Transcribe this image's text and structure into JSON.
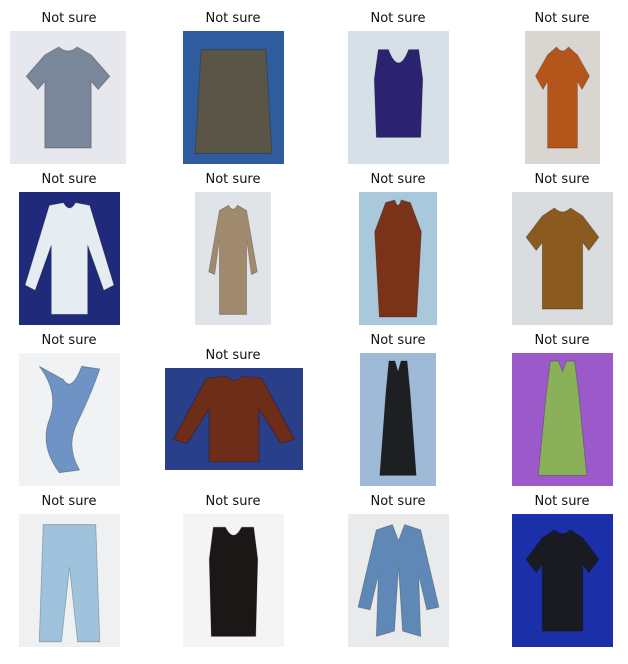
{
  "grid": {
    "cells": [
      {
        "label": "Not sure",
        "image": "grey-tshirt-on-bedsheet",
        "bg": "#e6e8ee",
        "garment": "#7a8699"
      },
      {
        "label": "Not sure",
        "image": "tweed-skirt-on-denim",
        "bg": "#2f5c9e",
        "garment": "#5b5547"
      },
      {
        "label": "Not sure",
        "image": "purple-vest-on-tiles",
        "bg": "#d7e0e6",
        "garment": "#2c2370"
      },
      {
        "label": "Not sure",
        "image": "rust-tshirt-on-hanger",
        "bg": "#d9d6d2",
        "garment": "#b4561c"
      },
      {
        "label": "Not sure",
        "image": "white-blouse-on-navy",
        "bg": "#1f2a7a",
        "garment": "#e5ecf2"
      },
      {
        "label": "Not sure",
        "image": "beige-shirt-on-hanger",
        "bg": "#e0e4e8",
        "garment": "#a08a6e"
      },
      {
        "label": "Not sure",
        "image": "rust-tunic-on-blue",
        "bg": "#a9c8dc",
        "garment": "#7a3318"
      },
      {
        "label": "Not sure",
        "image": "brown-top-yellow-trim",
        "bg": "#d9dde0",
        "garment": "#8a5a1e"
      },
      {
        "label": "Not sure",
        "image": "denim-scarf",
        "bg": "#f1f2f4",
        "garment": "#6f93c4"
      },
      {
        "label": "Not sure",
        "image": "brown-blouse-on-floral",
        "bg": "#2a3f8a",
        "garment": "#6e2d18"
      },
      {
        "label": "Not sure",
        "image": "black-dress-on-blue",
        "bg": "#9fbad6",
        "garment": "#1e1f22"
      },
      {
        "label": "Not sure",
        "image": "green-dress-on-purple",
        "bg": "#9b59c9",
        "garment": "#8ab05a"
      },
      {
        "label": "Not sure",
        "image": "lightblue-trousers",
        "bg": "#eef0f2",
        "garment": "#9fc3dc"
      },
      {
        "label": "Not sure",
        "image": "black-sleeveless-top",
        "bg": "#f4f4f4",
        "garment": "#1b1717"
      },
      {
        "label": "Not sure",
        "image": "blue-cardigan-on-hanger",
        "bg": "#e9eaec",
        "garment": "#5f88b6"
      },
      {
        "label": "Not sure",
        "image": "black-shirt-on-blue",
        "bg": "#1a2fa8",
        "garment": "#1a1b20"
      }
    ]
  }
}
